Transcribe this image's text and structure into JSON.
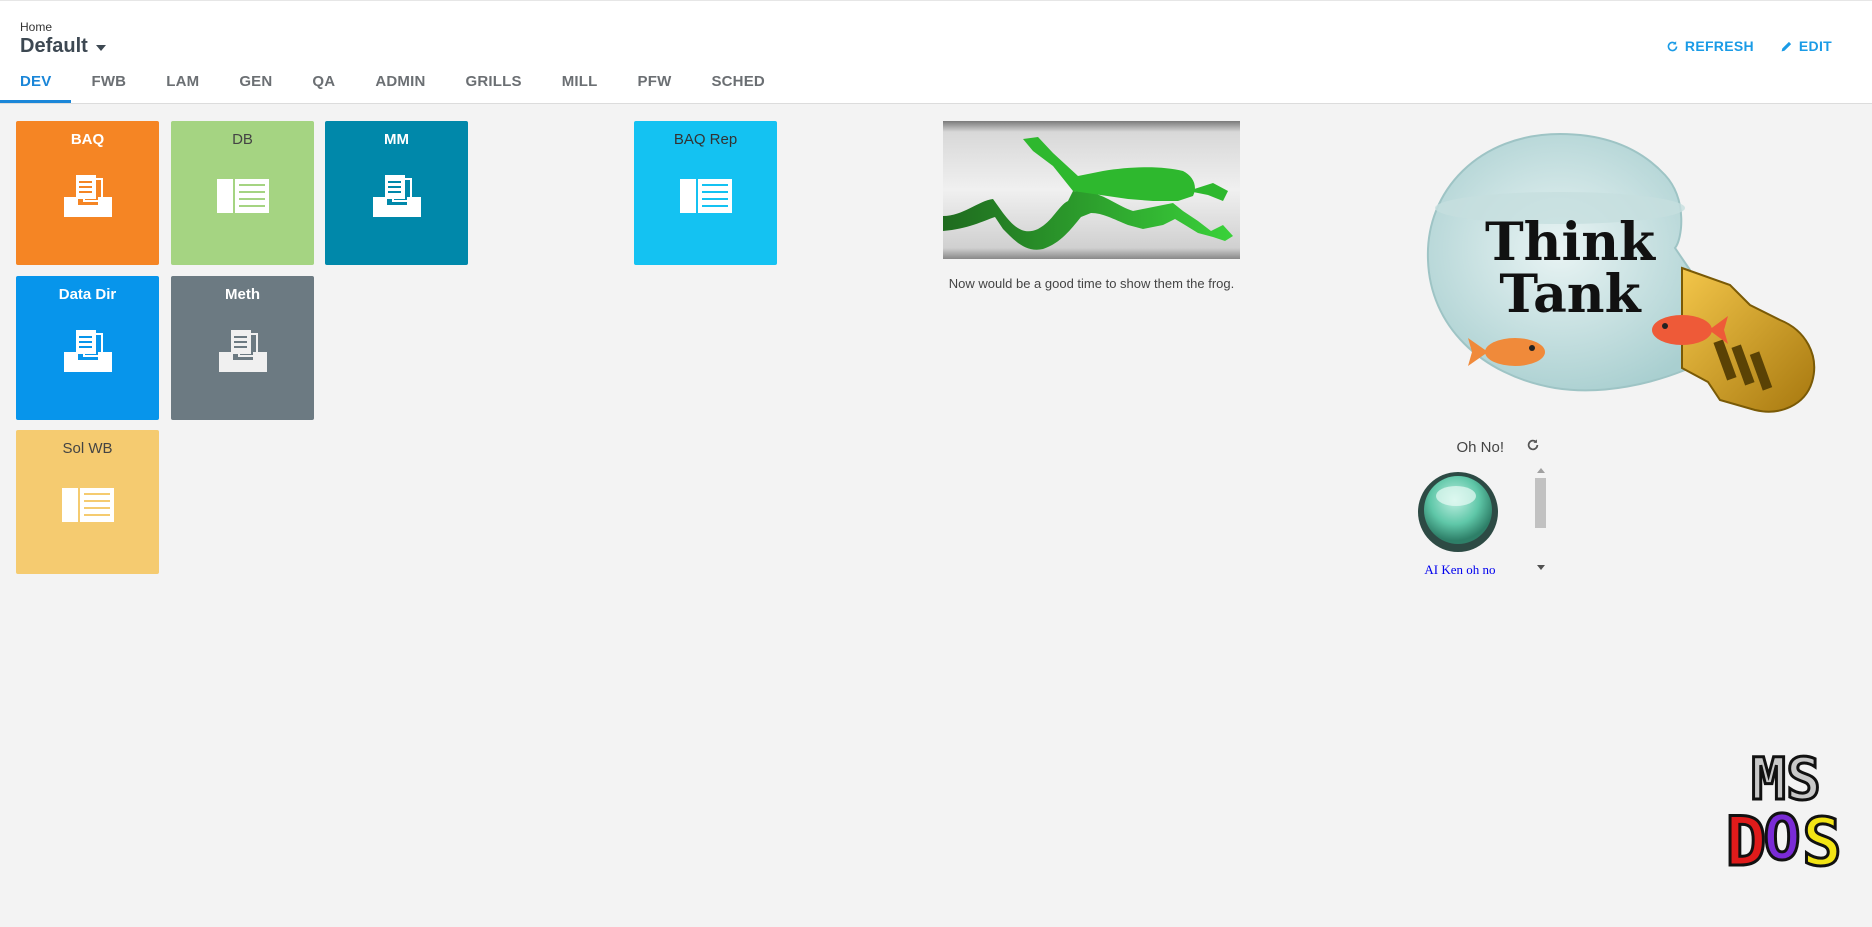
{
  "header": {
    "breadcrumb": "Home",
    "title": "Default",
    "actions": {
      "refresh": "REFRESH",
      "edit": "EDIT"
    },
    "tabs": [
      {
        "label": "DEV",
        "active": true
      },
      {
        "label": "FWB"
      },
      {
        "label": "LAM"
      },
      {
        "label": "GEN"
      },
      {
        "label": "QA"
      },
      {
        "label": "ADMIN"
      },
      {
        "label": "GRILLS"
      },
      {
        "label": "MILL"
      },
      {
        "label": "PFW"
      },
      {
        "label": "SCHED"
      }
    ]
  },
  "tiles": {
    "baq": {
      "label": "BAQ",
      "color": "#f58524",
      "icon": "report-documents-icon"
    },
    "db": {
      "label": "DB",
      "color": "#a5d482",
      "icon": "dashboard-panel-icon"
    },
    "mm": {
      "label": "MM",
      "color": "#0088aa",
      "icon": "report-documents-icon"
    },
    "baq_rep": {
      "label": "BAQ Rep",
      "color": "#14c2f2",
      "icon": "dashboard-panel-icon"
    },
    "data_dir": {
      "label": "Data Dir",
      "color": "#0795eb",
      "icon": "report-documents-icon"
    },
    "meth": {
      "label": "Meth",
      "color": "#6c7a82",
      "icon": "report-documents-icon"
    },
    "sol_wb": {
      "label": "Sol WB",
      "color": "#f5cb70",
      "icon": "dashboard-panel-icon"
    }
  },
  "frog_widget": {
    "caption": "Now would be a good time to show them the frog."
  },
  "think_tank": {
    "line1": "Think",
    "line2": "Tank"
  },
  "ohno_widget": {
    "title": "Oh No!",
    "link": "AI Ken oh no"
  },
  "msdos_logo": {
    "line1": "MS",
    "line2": "DOS"
  },
  "colors": {
    "accent": "#1a86d8",
    "background": "#f3f3f3"
  }
}
